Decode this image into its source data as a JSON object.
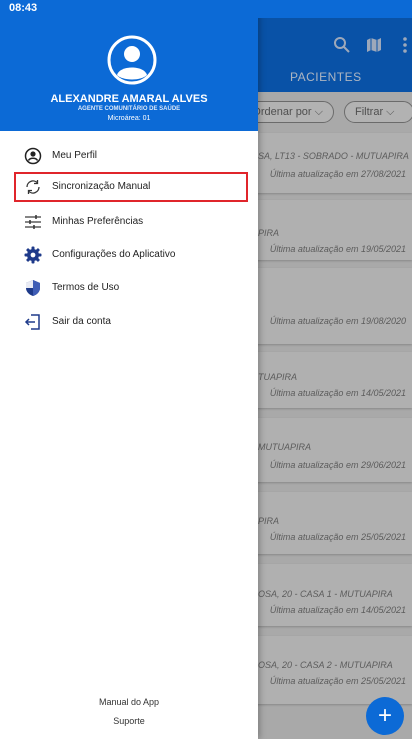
{
  "status_bar": {
    "time": "08:43"
  },
  "app": {
    "header_title": "PACIENTES",
    "sort_label": "Ordenar por",
    "filter_label": "Filtrar",
    "cards": [
      {
        "address": "SA, LT13 - SOBRADO - MUTUAPIRA",
        "updated": "Última atualização em 27/08/2021"
      },
      {
        "address": "PIRA",
        "updated": "Última atualização em 19/05/2021"
      },
      {
        "address": "",
        "updated": "Última atualização em 19/08/2020"
      },
      {
        "address": "TUAPIRA",
        "updated": "Última atualização em 14/05/2021"
      },
      {
        "address": "MUTUAPIRA",
        "updated": "Última atualização em 29/06/2021"
      },
      {
        "address": "PIRA",
        "updated": "Última atualização em 25/05/2021"
      },
      {
        "address": "OSA, 20 - CASA 1 - MUTUAPIRA",
        "updated": "Última atualização em 14/05/2021"
      },
      {
        "address": "OSA, 20 - CASA 2 - MUTUAPIRA",
        "updated": "Última atualização em 25/05/2021"
      }
    ],
    "fab_label": "+"
  },
  "drawer": {
    "user_name": "ALEXANDRE AMARAL ALVES",
    "user_role": "AGENTE COMUNITÁRIO DE SAÚDE",
    "user_area": "Microárea: 01",
    "menu": [
      {
        "label": "Meu Perfil",
        "icon": "profile-icon"
      },
      {
        "label": "Sincronização Manual",
        "icon": "sync-icon"
      },
      {
        "label": "Minhas Preferências",
        "icon": "sliders-icon"
      },
      {
        "label": "Configurações do Aplicativo",
        "icon": "gear-icon"
      },
      {
        "label": "Termos de Uso",
        "icon": "shield-icon"
      },
      {
        "label": "Sair da conta",
        "icon": "logout-icon"
      }
    ],
    "footer": {
      "manual": "Manual do App",
      "support": "Suporte"
    }
  },
  "colors": {
    "primary": "#0c6ad6",
    "highlight": "#e0252b"
  }
}
